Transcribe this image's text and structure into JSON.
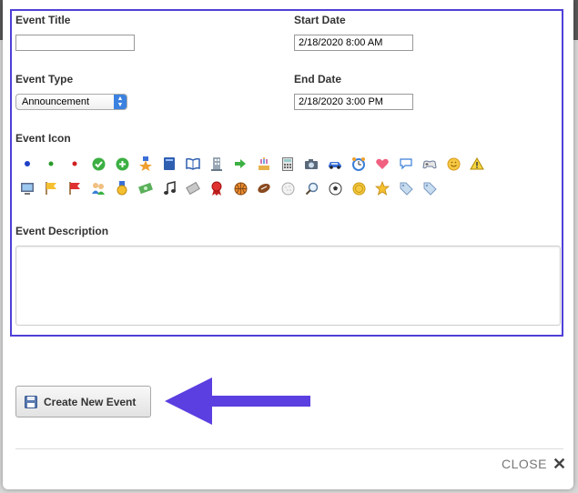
{
  "form": {
    "title_label": "Event Title",
    "title_value": "",
    "start_label": "Start Date",
    "start_value": "2/18/2020 8:00 AM",
    "type_label": "Event Type",
    "type_value": "Announcement",
    "end_label": "End Date",
    "end_value": "2/18/2020 3:00 PM",
    "icon_label": "Event Icon",
    "description_label": "Event Description",
    "description_value": ""
  },
  "icons_row1": [
    "blue-dot",
    "green-dot",
    "red-dot",
    "green-check",
    "green-plus",
    "star-medal",
    "blue-book",
    "open-book",
    "building",
    "green-arrow",
    "birthday-cake",
    "calculator",
    "camera",
    "car",
    "alarm-clock",
    "heart",
    "speech-bubble",
    "gamepad",
    "smiley",
    "warning"
  ],
  "icons_row2": [
    "computer",
    "yellow-flag",
    "red-flag",
    "people",
    "gold-medal",
    "money",
    "music-note",
    "ticket",
    "red-ribbon",
    "basketball",
    "football",
    "golf-ball",
    "magnifier",
    "soccer-ball",
    "gold-coin",
    "gold-star",
    "blue-tag",
    "blue-tag-2"
  ],
  "actions": {
    "create_label": "Create New Event",
    "close_label": "CLOSE"
  },
  "colors": {
    "highlight": "#4f3fd8",
    "arrow": "#5b3fe0"
  }
}
